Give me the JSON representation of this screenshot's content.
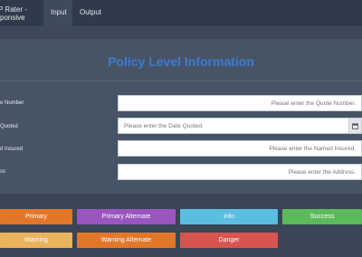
{
  "app": {
    "title_line1": "P Rater -",
    "title_line2": "sponsive"
  },
  "tabs": [
    {
      "label": "Input",
      "active": true
    },
    {
      "label": "Output",
      "active": false
    }
  ],
  "section": {
    "heading": "Policy Level Information"
  },
  "fields": [
    {
      "label": "e Number",
      "placeholder": "Please enter the Quote Number."
    },
    {
      "label": "Quoted",
      "placeholder": "Please enter the Date Quoted."
    },
    {
      "label": "d Insured",
      "placeholder": "Please enter the Named Insured."
    },
    {
      "label": "ss",
      "placeholder": "Please enter the Address."
    }
  ],
  "buttons": [
    {
      "label": "Primary",
      "color": "#e2772a"
    },
    {
      "label": "Primary Alternate",
      "color": "#9b55bf"
    },
    {
      "label": "Info",
      "color": "#5bbde0"
    },
    {
      "label": "Success",
      "color": "#5cba5c"
    },
    {
      "label": "Warning",
      "color": "#eab35c"
    },
    {
      "label": "Warning Alternate",
      "color": "#e2772a"
    },
    {
      "label": "Danger",
      "color": "#d9534f"
    }
  ]
}
